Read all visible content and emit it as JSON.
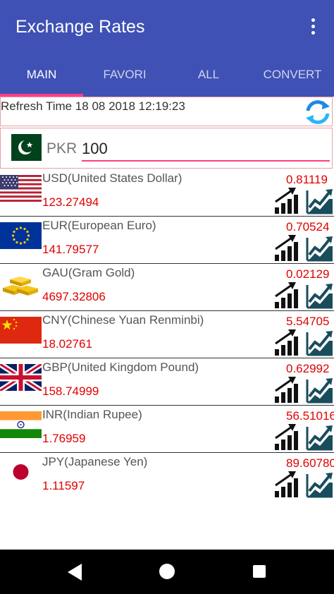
{
  "app": {
    "title": "Exchange Rates"
  },
  "tabs": [
    {
      "label": "MAIN",
      "active": true
    },
    {
      "label": "FAVORI",
      "active": false
    },
    {
      "label": "ALL",
      "active": false
    },
    {
      "label": "CONVERT",
      "active": false
    }
  ],
  "refresh": {
    "text": "Refresh Time 18 08 2018 12:19:23"
  },
  "input": {
    "currency": "PKR",
    "amount": "100"
  },
  "currencies": [
    {
      "name": "USD(United States Dollar)",
      "rate": "0.81119",
      "value": "123.27494",
      "flag": "us-flag-icon"
    },
    {
      "name": "EUR(European Euro)",
      "rate": "0.70524",
      "value": "141.79577",
      "flag": "eu-flag-icon"
    },
    {
      "name": "GAU(Gram Gold)",
      "rate": "0.02129",
      "value": "4697.32806",
      "flag": "gold-bars-icon"
    },
    {
      "name": "CNY(Chinese Yuan Renminbi)",
      "rate": "5.54705",
      "value": "18.02761",
      "flag": "cn-flag-icon"
    },
    {
      "name": "GBP(United Kingdom Pound)",
      "rate": "0.62992",
      "value": "158.74999",
      "flag": "gb-flag-icon"
    },
    {
      "name": "INR(Indian Rupee)",
      "rate": "56.51016",
      "value": "1.76959",
      "flag": "in-flag-icon"
    },
    {
      "name": "JPY(Japanese Yen)",
      "rate": "89.60780",
      "value": "1.11597",
      "flag": "jp-flag-icon"
    }
  ],
  "colors": {
    "primary": "#3f51b5",
    "accent": "#ff4081",
    "rate_text": "#e00000",
    "trend": "#1a4d5c"
  }
}
